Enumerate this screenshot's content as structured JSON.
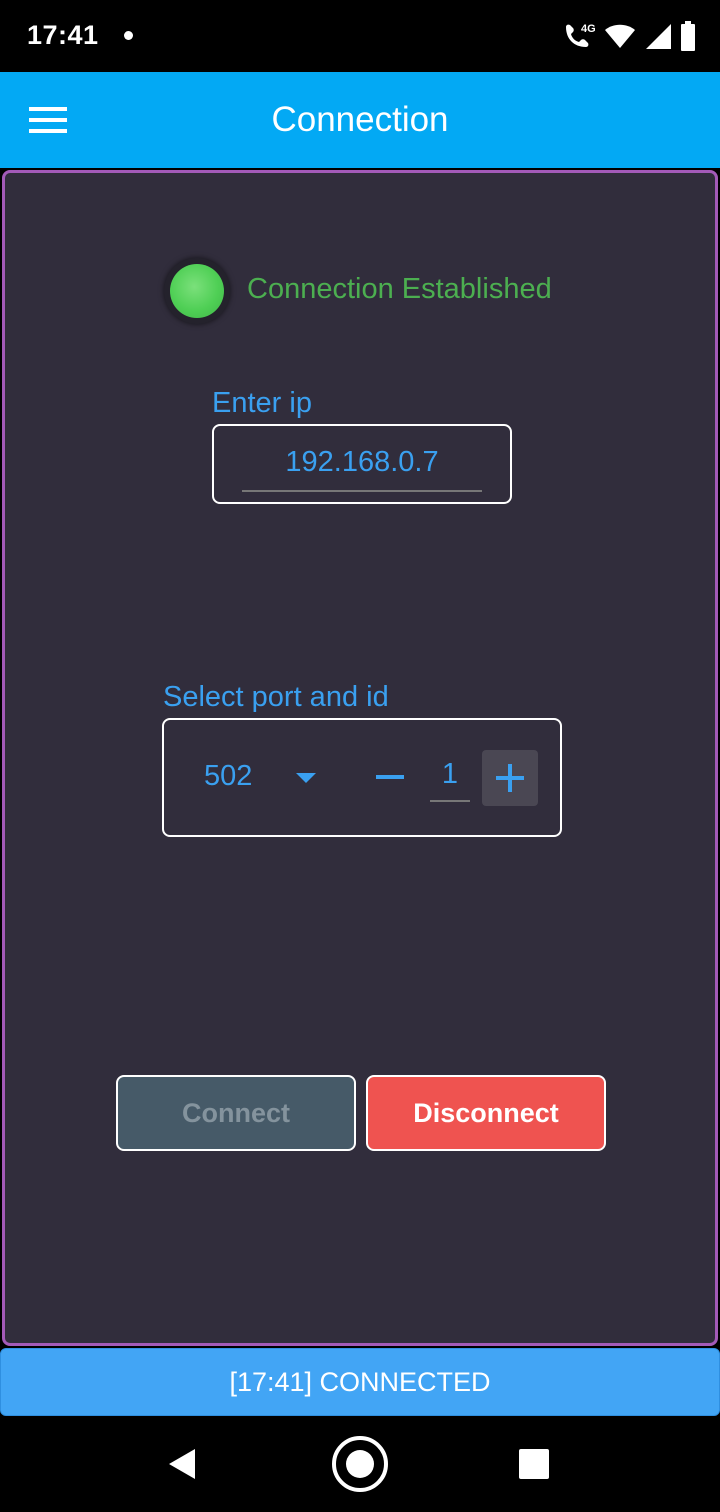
{
  "status_bar": {
    "time": "17:41",
    "network": "4G",
    "icons": [
      "notification-dot-icon",
      "wifi-calling-icon",
      "wifi-icon",
      "cell-signal-icon",
      "battery-icon"
    ]
  },
  "app_bar": {
    "title": "Connection",
    "menu_icon": "hamburger-menu-icon",
    "background": "#03a9f4"
  },
  "connection": {
    "status_text": "Connection Established",
    "status_color": "#4caf50",
    "indicator_icon": "green-led-indicator"
  },
  "ip": {
    "label": "Enter ip",
    "value": "192.168.0.7"
  },
  "port": {
    "label": "Select port and id",
    "selected": "502",
    "id_value": "1"
  },
  "buttons": {
    "connect_label": "Connect",
    "disconnect_label": "Disconnect",
    "disconnect_color": "#ef5350"
  },
  "footer": {
    "status_text": "[17:41] CONNECTED"
  },
  "colors": {
    "panel_bg": "#312d3c",
    "panel_border": "#a35ab8",
    "accent_text": "#3aa0f0"
  }
}
